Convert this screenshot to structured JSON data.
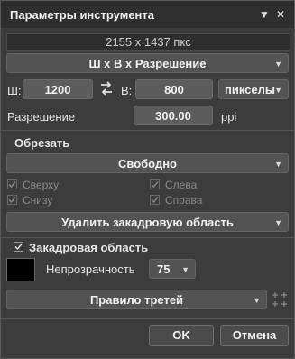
{
  "window": {
    "title": "Параметры инструмента"
  },
  "image_size": "2155 x 1437 пкс",
  "size_mode": "Ш x В x Разрешение",
  "width": {
    "label": "Ш:",
    "value": "1200"
  },
  "height": {
    "label": "В:",
    "value": "800"
  },
  "units": "пикселы",
  "resolution": {
    "label": "Разрешение",
    "value": "300.00",
    "unit": "ppi"
  },
  "crop": {
    "section": "Обрезать",
    "mode": "Свободно",
    "sides": {
      "top": "Сверху",
      "left": "Слева",
      "bottom": "Снизу",
      "right": "Справа"
    },
    "action": "Удалить закадровую область"
  },
  "outside": {
    "section": "Закадровая область",
    "opacity_label": "Непрозрачность",
    "opacity_value": "75",
    "color": "#000000"
  },
  "overlay": "Правило третей",
  "buttons": {
    "ok": "OK",
    "cancel": "Отмена"
  }
}
